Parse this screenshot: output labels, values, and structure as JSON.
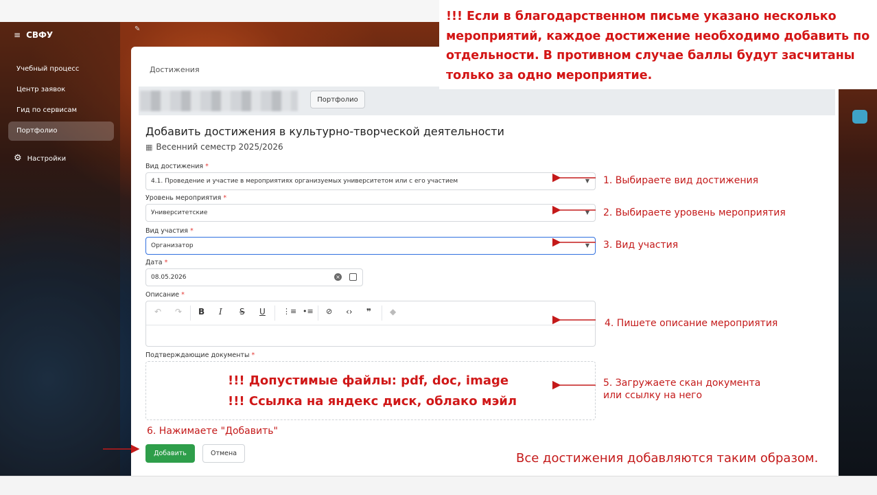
{
  "sidebar": {
    "brand": "СВФУ",
    "items": [
      {
        "label": "Учебный процесс"
      },
      {
        "label": "Центр заявок"
      },
      {
        "label": "Гид по сервисам"
      },
      {
        "label": "Портфолио",
        "active": true
      },
      {
        "label": "Настройки"
      }
    ]
  },
  "breadcrumb": "Достижения",
  "profile": {
    "portfolio_button": "Портфолио"
  },
  "form": {
    "title": "Добавить достижения в культурно-творческой деятельности",
    "semester": "Весенний семестр 2025/2026",
    "required_mark": "*",
    "achievement_type": {
      "label": "Вид достижения",
      "value": "4.1. Проведение и участие в мероприятиях организуемых университетом или с его участием"
    },
    "event_level": {
      "label": "Уровень мероприятия",
      "value": "Университетские"
    },
    "participation_type": {
      "label": "Вид участия",
      "value": "Организатор"
    },
    "date": {
      "label": "Дата",
      "value": "08.05.2026"
    },
    "description": {
      "label": "Описание",
      "value": ""
    },
    "documents": {
      "label": "Подтверждающие документы"
    },
    "add_button": "Добавить",
    "cancel_button": "Отмена"
  },
  "annotations": {
    "top_note": "!!! Если в благодарственном письме указано несколько мероприятий, каждое достижение необходимо добавить по отдельности. В противном случае баллы будут засчитаны только за одно мероприятие.",
    "step1": "1. Выбираете вид достижения",
    "step2": "2. Выбираете уровень мероприятия",
    "step3": "3. Вид участия",
    "step4": "4. Пишете описание мероприятия",
    "step5_line1": "5. Загружаете скан документа",
    "step5_line2": "или ссылку на него",
    "step6": "6. Нажимаете \"Добавить\"",
    "files_line1": "!!! Допустимые файлы: pdf, doc, image",
    "files_line2": "!!! Ссылка на яндекс диск, облако мэйл",
    "footer": "Все достижения добавляются таким образом."
  },
  "colors": {
    "annotation_red": "#c41a1a",
    "add_button_green": "#2e9e4a",
    "focus_blue": "#2f6fdf"
  }
}
